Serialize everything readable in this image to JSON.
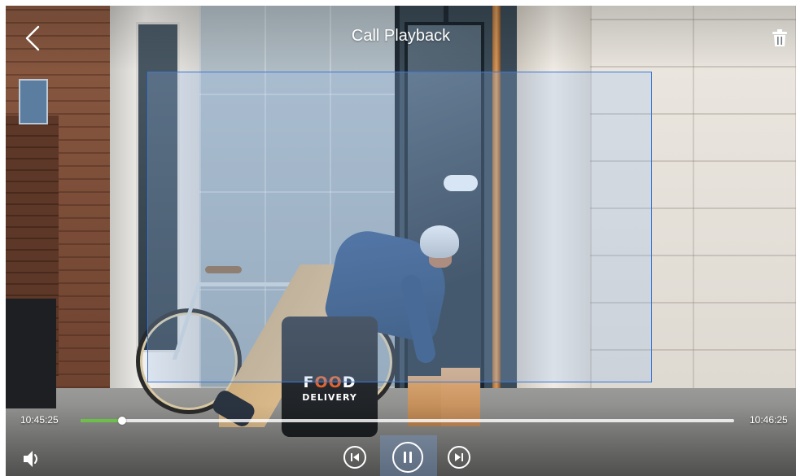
{
  "header": {
    "title": "Call Playback",
    "back_icon": "chevron-left-icon",
    "delete_icon": "trash-icon"
  },
  "video": {
    "backpack_logo_line1_pre": "F",
    "backpack_logo_line1_mid": "OO",
    "backpack_logo_line1_post": "D",
    "backpack_logo_line2": "DELIVERY"
  },
  "playback": {
    "current_time": "10:45:25",
    "end_time": "10:46:25",
    "progress_fraction": 0.063,
    "progress_color": "#6cc04a"
  },
  "controls": {
    "volume_icon": "speaker-icon",
    "previous_icon": "skip-previous-icon",
    "pause_icon": "pause-icon",
    "next_icon": "skip-next-icon"
  },
  "colors": {
    "roi_border": "#3b77d6",
    "roi_fill": "rgba(150,190,245,0.25)"
  }
}
